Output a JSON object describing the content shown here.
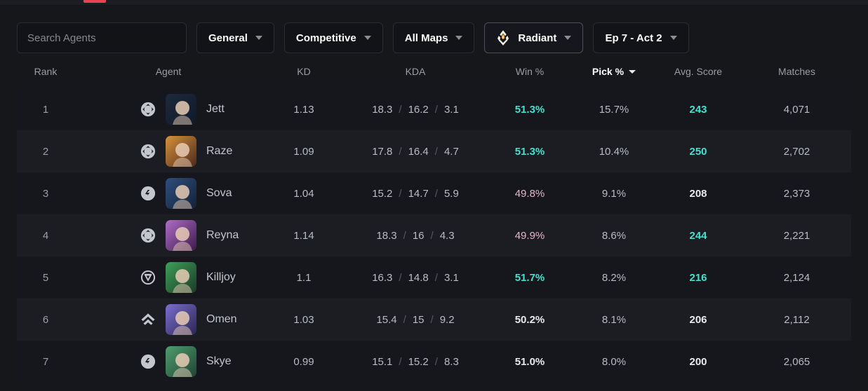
{
  "colors": {
    "accent_red": "#ec4055",
    "teal": "#45e0cf",
    "pink": "#e8b6c4",
    "white": "#e9eaee",
    "page_bg": "#16171b",
    "row_odd": "#16171c",
    "row_even": "#1b1d23"
  },
  "filter_bar": {
    "search": {
      "placeholder": "Search Agents",
      "value": "",
      "icon": "search-input"
    },
    "dropdowns": [
      {
        "id": "mode-general",
        "label": "General",
        "icon": "chevron-down-icon",
        "highlighted": false
      },
      {
        "id": "queue",
        "label": "Competitive",
        "icon": "chevron-down-icon",
        "highlighted": false
      },
      {
        "id": "maps",
        "label": "All Maps",
        "icon": "chevron-down-icon",
        "highlighted": false
      },
      {
        "id": "rank",
        "label": "Radiant",
        "icon": "radiant-rank-icon",
        "highlighted": true
      },
      {
        "id": "act",
        "label": "Ep 7 - Act 2",
        "icon": "chevron-down-icon",
        "highlighted": false
      }
    ]
  },
  "table": {
    "columns": [
      {
        "key": "rank",
        "label": "Rank",
        "sorted": false
      },
      {
        "key": "agent",
        "label": "Agent",
        "sorted": false
      },
      {
        "key": "kd",
        "label": "KD",
        "sorted": false
      },
      {
        "key": "kda",
        "label": "KDA",
        "sorted": false
      },
      {
        "key": "win",
        "label": "Win %",
        "sorted": false
      },
      {
        "key": "pick",
        "label": "Pick %",
        "sorted": true,
        "sort_dir": "desc",
        "icon": "sort-desc-caret-icon"
      },
      {
        "key": "score",
        "label": "Avg. Score",
        "sorted": false
      },
      {
        "key": "matches",
        "label": "Matches",
        "sorted": false
      }
    ],
    "rows": [
      {
        "rank": "1",
        "agent": "Jett",
        "role": "duelist",
        "role_icon": "duelist-role-icon",
        "portrait": "jett-portrait",
        "kd": "1.13",
        "kills": "18.3",
        "deaths": "16.2",
        "assists": "3.1",
        "win": "51.3%",
        "win_state": "up",
        "pick": "15.7%",
        "score": "243",
        "score_state": "up",
        "matches": "4,071"
      },
      {
        "rank": "2",
        "agent": "Raze",
        "role": "duelist",
        "role_icon": "duelist-role-icon",
        "portrait": "raze-portrait",
        "kd": "1.09",
        "kills": "17.8",
        "deaths": "16.4",
        "assists": "4.7",
        "win": "51.3%",
        "win_state": "up",
        "pick": "10.4%",
        "score": "250",
        "score_state": "up",
        "matches": "2,702"
      },
      {
        "rank": "3",
        "agent": "Sova",
        "role": "initiator",
        "role_icon": "initiator-role-icon",
        "portrait": "sova-portrait",
        "kd": "1.04",
        "kills": "15.2",
        "deaths": "14.7",
        "assists": "5.9",
        "win": "49.8%",
        "win_state": "down",
        "pick": "9.1%",
        "score": "208",
        "score_state": "flat",
        "matches": "2,373"
      },
      {
        "rank": "4",
        "agent": "Reyna",
        "role": "duelist",
        "role_icon": "duelist-role-icon",
        "portrait": "reyna-portrait",
        "kd": "1.14",
        "kills": "18.3",
        "deaths": "16",
        "assists": "4.3",
        "win": "49.9%",
        "win_state": "down",
        "pick": "8.6%",
        "score": "244",
        "score_state": "up",
        "matches": "2,221"
      },
      {
        "rank": "5",
        "agent": "Killjoy",
        "role": "sentinel",
        "role_icon": "sentinel-role-icon",
        "portrait": "killjoy-portrait",
        "kd": "1.1",
        "kills": "16.3",
        "deaths": "14.8",
        "assists": "3.1",
        "win": "51.7%",
        "win_state": "up",
        "pick": "8.2%",
        "score": "216",
        "score_state": "up",
        "matches": "2,124"
      },
      {
        "rank": "6",
        "agent": "Omen",
        "role": "controller",
        "role_icon": "controller-role-icon",
        "portrait": "omen-portrait",
        "kd": "1.03",
        "kills": "15.4",
        "deaths": "15",
        "assists": "9.2",
        "win": "50.2%",
        "win_state": "neutral",
        "pick": "8.1%",
        "score": "206",
        "score_state": "flat",
        "matches": "2,112"
      },
      {
        "rank": "7",
        "agent": "Skye",
        "role": "initiator",
        "role_icon": "initiator-role-icon",
        "portrait": "skye-portrait",
        "kd": "0.99",
        "kills": "15.1",
        "deaths": "15.2",
        "assists": "8.3",
        "win": "51.0%",
        "win_state": "neutral",
        "pick": "8.0%",
        "score": "200",
        "score_state": "flat",
        "matches": "2,065"
      }
    ],
    "kda_separator": "/"
  }
}
